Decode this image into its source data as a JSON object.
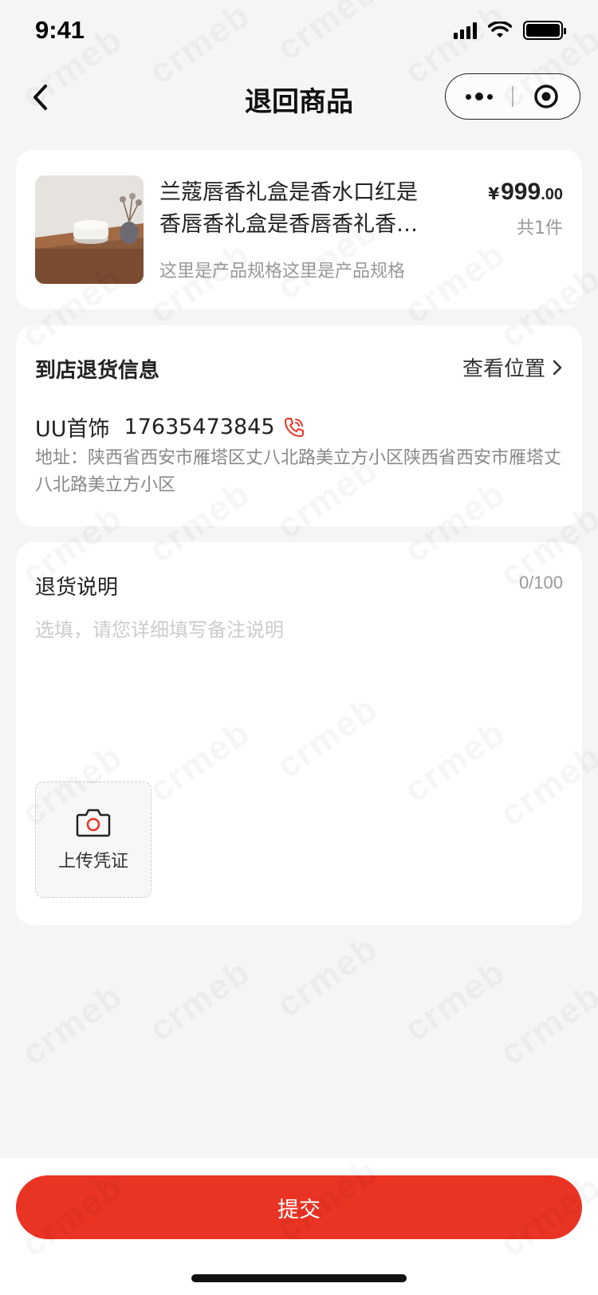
{
  "status_bar": {
    "time": "9:41"
  },
  "nav": {
    "title": "退回商品"
  },
  "product": {
    "name": "兰蔻唇香礼盒是香水口红是香唇香礼盒是香唇香礼香唇香礼盒是香唇香礼盒",
    "spec": "这里是产品规格这里是产品规格",
    "price_symbol": "¥",
    "price_int": "999",
    "price_dec": ".00",
    "quantity": "共1件"
  },
  "store_info": {
    "title": "到店退货信息",
    "view_location": "查看位置",
    "store_name": "UU首饰",
    "phone": "17635473845",
    "address": "地址：陕西省西安市雁塔区丈八北路美立方小区陕西省西安市雁塔丈八北路美立方小区"
  },
  "return_note": {
    "title": "退货说明",
    "count": "0/100",
    "placeholder": "选填，请您详细填写备注说明",
    "upload_label": "上传凭证"
  },
  "submit": {
    "label": "提交"
  },
  "watermark": {
    "text": "crmeb"
  },
  "colors": {
    "accent": "#e93323",
    "background": "#f5f5f5",
    "card": "#ffffff"
  }
}
